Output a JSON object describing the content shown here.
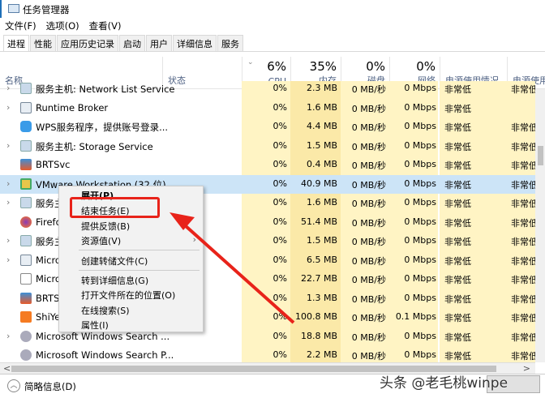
{
  "window": {
    "title": "任务管理器"
  },
  "menubar": [
    "文件(F)",
    "选项(O)",
    "查看(V)"
  ],
  "tabs": [
    "进程",
    "性能",
    "应用历史记录",
    "启动",
    "用户",
    "详细信息",
    "服务"
  ],
  "header": {
    "name": "名称",
    "status": "状态",
    "cpu_pct": "6%",
    "cpu": "CPU",
    "mem_pct": "35%",
    "mem": "内存",
    "disk_pct": "0%",
    "disk": "磁盘",
    "net_pct": "0%",
    "net": "网络",
    "power": "电源使用情况",
    "power_trend": "电源使用"
  },
  "rows": [
    {
      "name": "服务主机: Network List Service",
      "cpu": "0%",
      "mem": "2.3 MB",
      "disk": "0 MB/秒",
      "net": "0 Mbps",
      "power": "非常低",
      "trend": "非常低",
      "expand": true,
      "icon": "gear"
    },
    {
      "name": "Runtime Broker",
      "cpu": "0%",
      "mem": "1.6 MB",
      "disk": "0 MB/秒",
      "net": "0 Mbps",
      "power": "非常低",
      "trend": "",
      "expand": true,
      "icon": "window"
    },
    {
      "name": "WPS服务程序，提供账号登录...",
      "cpu": "0%",
      "mem": "4.4 MB",
      "disk": "0 MB/秒",
      "net": "0 Mbps",
      "power": "非常低",
      "trend": "非常低",
      "expand": false,
      "icon": "cloud"
    },
    {
      "name": "服务主机: Storage Service",
      "cpu": "0%",
      "mem": "1.5 MB",
      "disk": "0 MB/秒",
      "net": "0 Mbps",
      "power": "非常低",
      "trend": "非常低",
      "expand": true,
      "icon": "gear"
    },
    {
      "name": "BRTSvc",
      "cpu": "0%",
      "mem": "0.4 MB",
      "disk": "0 MB/秒",
      "net": "0 Mbps",
      "power": "非常低",
      "trend": "非常低",
      "expand": false,
      "icon": "brt"
    },
    {
      "name": "VMware Workstation (32 位)",
      "cpu": "0%",
      "mem": "40.9 MB",
      "disk": "0 MB/秒",
      "net": "0 Mbps",
      "power": "非常低",
      "trend": "非常低",
      "expand": true,
      "icon": "vmware",
      "selected": true
    },
    {
      "name": "服务主机",
      "cpu": "0%",
      "mem": "1.6 MB",
      "disk": "0 MB/秒",
      "net": "0 Mbps",
      "power": "非常低",
      "trend": "非常低",
      "expand": true,
      "icon": "gear"
    },
    {
      "name": "Firefox",
      "cpu": "0%",
      "mem": "51.4 MB",
      "disk": "0 MB/秒",
      "net": "0 Mbps",
      "power": "非常低",
      "trend": "非常低",
      "expand": false,
      "icon": "firefox"
    },
    {
      "name": "服务主机",
      "cpu": "0%",
      "mem": "1.5 MB",
      "disk": "0 MB/秒",
      "net": "0 Mbps",
      "power": "非常低",
      "trend": "非常低",
      "expand": true,
      "icon": "gear"
    },
    {
      "name": "Micro",
      "cpu": "0%",
      "mem": "6.5 MB",
      "disk": "0 MB/秒",
      "net": "0 Mbps",
      "power": "非常低",
      "trend": "非常低",
      "expand": true,
      "icon": "window"
    },
    {
      "name": "Micro",
      "cpu": "0%",
      "mem": "22.7 MB",
      "disk": "0 MB/秒",
      "net": "0 Mbps",
      "power": "非常低",
      "trend": "非常低",
      "expand": false,
      "icon": "ime"
    },
    {
      "name": "BRTS",
      "cpu": "0%",
      "mem": "1.3 MB",
      "disk": "0 MB/秒",
      "net": "0 Mbps",
      "power": "非常低",
      "trend": "非常低",
      "expand": false,
      "icon": "brt"
    },
    {
      "name": "ShiYe",
      "cpu": "0%",
      "mem": "100.8 MB",
      "disk": "0 MB/秒",
      "net": "0.1 Mbps",
      "power": "非常低",
      "trend": "非常低",
      "expand": false,
      "icon": "shiye"
    },
    {
      "name": "Microsoft Windows Search ...",
      "cpu": "0%",
      "mem": "18.8 MB",
      "disk": "0 MB/秒",
      "net": "0 Mbps",
      "power": "非常低",
      "trend": "非常低",
      "expand": true,
      "icon": "search"
    },
    {
      "name": "Microsoft Windows Search P...",
      "cpu": "0%",
      "mem": "2.2 MB",
      "disk": "0 MB/秒",
      "net": "0 Mbps",
      "power": "非常低",
      "trend": "非常低",
      "expand": false,
      "icon": "search"
    }
  ],
  "context_menu": {
    "items": [
      "展开(P)",
      "结束任务(E)",
      "提供反馈(B)",
      "资源值(V)",
      "创建转储文件(C)",
      "转到详细信息(G)",
      "打开文件所在的位置(O)",
      "在线搜索(S)",
      "属性(I)"
    ],
    "highlighted": "结束任务(E)"
  },
  "footer": {
    "brief": "简略信息(D)"
  },
  "watermark": "头条 @老毛桃winpe",
  "colors": {
    "highlight_box": "#e8231a",
    "selected_row": "#cce4f7",
    "heat": "#fff4c4"
  }
}
